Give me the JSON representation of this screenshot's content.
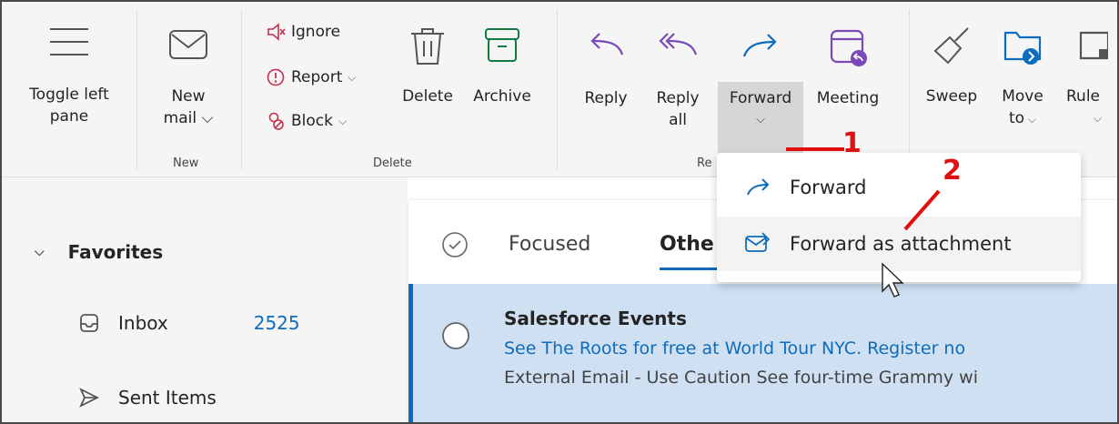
{
  "ribbon": {
    "toggle_left_pane": {
      "line1": "Toggle left",
      "line2": "pane"
    },
    "new_mail": {
      "line1": "New",
      "line2": "mail ⌵"
    },
    "ignore": "Ignore",
    "report": "Report",
    "block": "Block",
    "delete": "Delete",
    "archive": "Archive",
    "reply": "Reply",
    "reply_all": {
      "line1": "Reply",
      "line2": "all"
    },
    "forward": "Forward",
    "meeting": "Meeting",
    "sweep": "Sweep",
    "move_to": {
      "line1": "Move",
      "line2": "to"
    },
    "rules": "Rule",
    "groups": {
      "new": "New",
      "delete": "Delete",
      "respond": "Re"
    }
  },
  "forward_menu": {
    "items": [
      "Forward",
      "Forward as attachment"
    ]
  },
  "annotations": {
    "one": "1",
    "two": "2"
  },
  "nav": {
    "favorites": "Favorites",
    "inbox": "Inbox",
    "inbox_count": "2525",
    "sent_items": "Sent Items"
  },
  "list": {
    "tabs": {
      "focused": "Focused",
      "other": "Othe"
    },
    "message": {
      "sender": "Salesforce Events",
      "subject": "See The Roots for free at World Tour NYC. Register no",
      "preview": "External Email - Use Caution See four-time Grammy wi"
    }
  },
  "colors": {
    "accent": "#0f6cbd",
    "purple": "#7b48b8",
    "green": "#107c41",
    "annotation": "#e01010"
  }
}
